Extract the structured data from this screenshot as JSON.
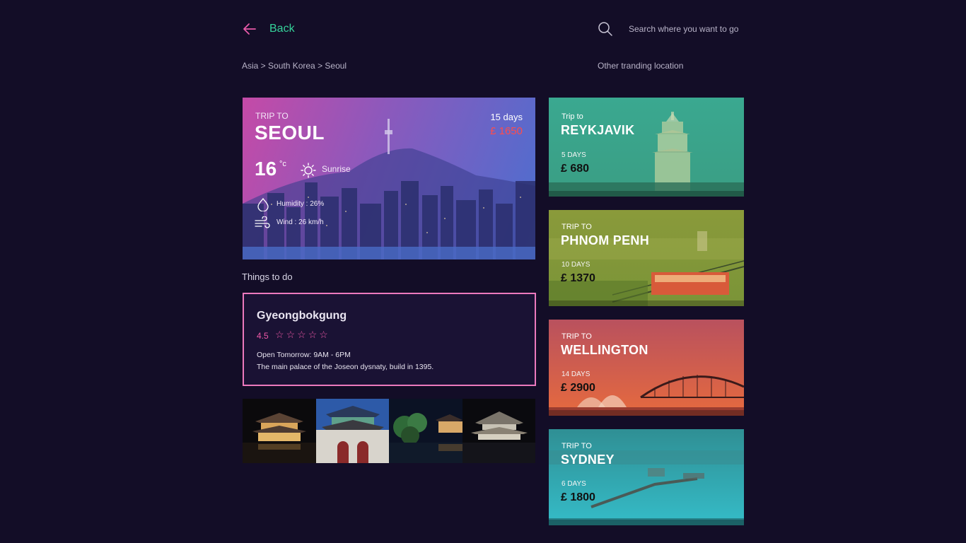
{
  "nav": {
    "back_label": "Back",
    "search_placeholder": "Search where you want to go"
  },
  "breadcrumb": {
    "text": "Asia > South Korea > Seoul"
  },
  "other_heading": "Other tranding location",
  "hero": {
    "trip_label": "TRIP TO",
    "city": "SEOUL",
    "days": "15 days",
    "price": "£ 1650",
    "temperature": "16",
    "temp_unit": "°c",
    "condition": "Sunrise",
    "humidity": "Humidity : 26%",
    "wind": "Wind : 26 km/h",
    "colors": {
      "price": "#ff4c4c"
    }
  },
  "things_heading": "Things to do",
  "attraction": {
    "name": "Gyeongbokgung",
    "rating": "4.5",
    "stars": [
      "☆",
      "☆",
      "☆",
      "☆",
      "☆"
    ],
    "hours": "Open Tomorrow: 9AM - 6PM",
    "description": "The main palace of the Joseon dysnaty, build in 1395.",
    "colors": {
      "accent": "#ec57a6"
    }
  },
  "trips": [
    {
      "trip_label": "Trip to",
      "city": "REYKJAVIK",
      "days": "5 DAYS",
      "price": "£ 680",
      "color": "#3aa890"
    },
    {
      "trip_label": "TRIP TO",
      "city": "PHNOM PENH",
      "days": "10 DAYS",
      "price": "£ 1370",
      "color": "#8a9a3a"
    },
    {
      "trip_label": "TRIP TO",
      "city": "WELLINGTON",
      "days": "14 DAYS",
      "price": "£ 2900",
      "color": "#d0584d"
    },
    {
      "trip_label": "TRIP TO",
      "city": "SYDNEY",
      "days": "6 DAYS",
      "price": "£ 1800",
      "color": "#2fb2b8"
    }
  ],
  "colors": {
    "background": "#130d27",
    "back_accent": "#35d29a",
    "back_arrow": "#e85aa9",
    "card_border": "#ec79bd"
  }
}
